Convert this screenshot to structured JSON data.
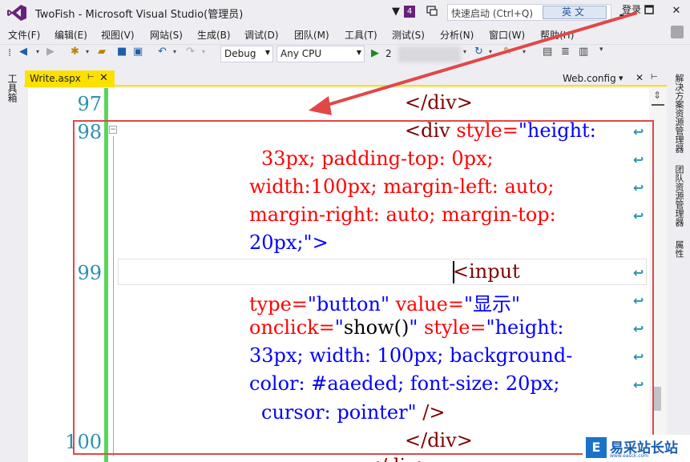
{
  "window": {
    "title": "TwoFish - Microsoft Visual Studio(管理员)",
    "notification_count": "4",
    "quick_launch_placeholder": "快速启动 (Ctrl+Q)",
    "ime_label": "英文",
    "min_glyph": "▬",
    "max_glyph": "■",
    "close_glyph": "✕"
  },
  "menu": [
    "文件(F)",
    "编辑(E)",
    "视图(V)",
    "网站(S)",
    "生成(B)",
    "调试(D)",
    "团队(M)",
    "工具(T)",
    "测试(S)",
    "分析(N)",
    "窗口(W)",
    "帮助(H)"
  ],
  "signin_label": "登录",
  "toolbar": {
    "config": "Debug",
    "platform": "Any CPU",
    "start_label": "2",
    "start_glyph": "▶"
  },
  "left_panel": {
    "toolbox": "工具箱"
  },
  "right_panel": {
    "tabs": [
      "解决方案资源管理器",
      "团队资源管理器",
      "属性"
    ]
  },
  "tabs": {
    "active": "Write.aspx",
    "pin_glyph": "⊢",
    "close_glyph": "✕",
    "preview": "Web.config",
    "dropdown_glyph": "▾"
  },
  "editor": {
    "line_numbers": [
      "97",
      "98",
      "99",
      "100"
    ],
    "lines": {
      "l97": "</div>",
      "l98a_tag": "<div ",
      "l98a_attr": "style=",
      "l98a_val": "\"height:",
      "l98b": "33px; padding-top: 0px;",
      "l98c": "width:100px; margin-left: auto;",
      "l98d": "margin-right: auto; margin-top:",
      "l98e": "20px;\">",
      "l99a": "<input",
      "l99b_attr1": "type=",
      "l99b_val1": "\"button\" ",
      "l99b_attr2": "value=",
      "l99b_val2": "\"显示\"",
      "l99c_attr": "onclick=",
      "l99c_val1": "\"",
      "l99c_plain": "show()",
      "l99c_val2": "\" ",
      "l99c_attr2": "style=",
      "l99c_val3": "\"height:",
      "l99d": "33px; width: 100px; background-",
      "l99e": "color: #aaeded; font-size: 20px;",
      "l99f_val": "cursor: pointer\" ",
      "l99f_tag": "/>",
      "l100": "</div>",
      "l101": "</div>"
    },
    "wrap_glyph": "↩"
  },
  "watermark": {
    "logo": "E",
    "text": "易采站长站",
    "sub": "www.easck.com"
  },
  "colors": {
    "accent_tab": "#fce100",
    "highlight": "#e04848",
    "line_number": "#2b91af",
    "tag": "#800000",
    "attribute": "#ff0000",
    "value": "#0000ff"
  }
}
